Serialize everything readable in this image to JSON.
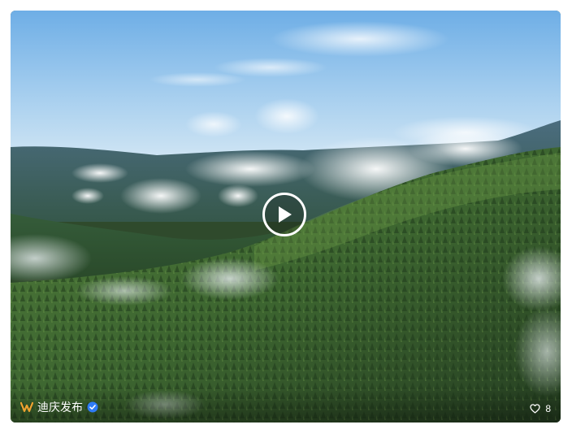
{
  "video_card": {
    "author_name": "迪庆发布",
    "like_count": "8",
    "icons": {
      "play": "play-icon",
      "logo": "brand-logo-icon",
      "verified": "verified-badge-icon",
      "like": "heart-icon"
    },
    "colors": {
      "logo": "#f0a330",
      "verified": "#2f7cf6",
      "overlay_text": "#ffffff"
    }
  }
}
